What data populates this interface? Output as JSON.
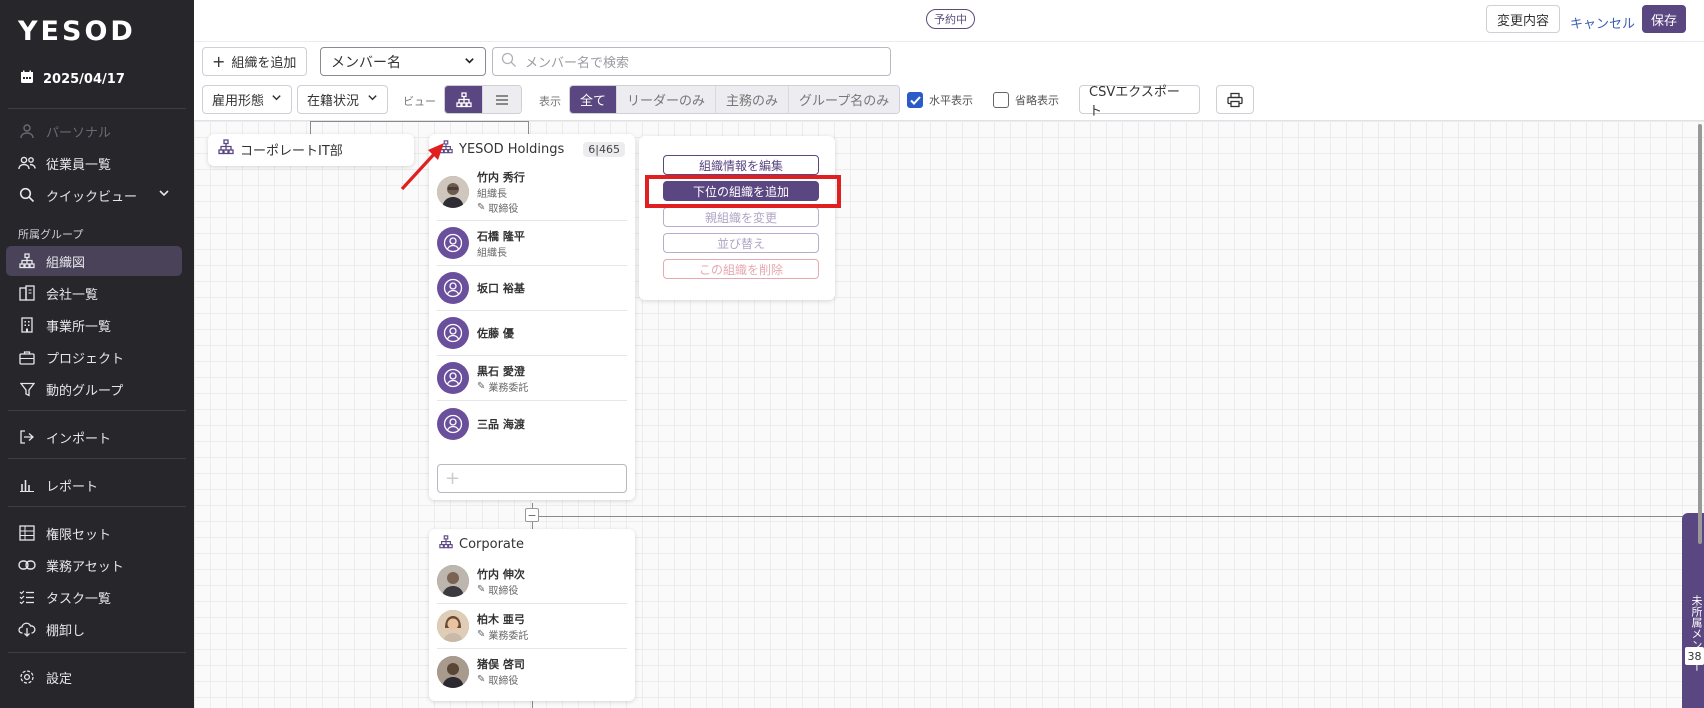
{
  "sidebar": {
    "logo": "YESOD",
    "date": "2025/04/17",
    "items_top": [
      {
        "label": "パーソナル",
        "icon": "person-icon",
        "muted": true
      },
      {
        "label": "従業員一覧",
        "icon": "people-icon"
      },
      {
        "label": "クイックビュー",
        "icon": "search-icon"
      }
    ],
    "section_label": "所属グループ",
    "items_group": [
      {
        "label": "組織図",
        "icon": "org-chart-icon",
        "active": true
      },
      {
        "label": "会社一覧",
        "icon": "company-icon"
      },
      {
        "label": "事業所一覧",
        "icon": "building-icon"
      },
      {
        "label": "プロジェクト",
        "icon": "briefcase-icon"
      },
      {
        "label": "動的グループ",
        "icon": "filter-icon"
      }
    ],
    "import": "インポート",
    "report": "レポート",
    "items_admin": [
      {
        "label": "権限セット",
        "icon": "grid-icon"
      },
      {
        "label": "業務アセット",
        "icon": "link-icon"
      },
      {
        "label": "タスク一覧",
        "icon": "task-list-icon"
      },
      {
        "label": "棚卸し",
        "icon": "cloud-download-icon"
      }
    ],
    "settings": "設定"
  },
  "topbar": {
    "status_badge": "予約中",
    "changes_button": "変更内容",
    "cancel_button": "キャンセル",
    "save_button": "保存"
  },
  "toolbar": {
    "add_org_button": "組織を追加",
    "member_select": "メンバー名",
    "search_placeholder": "メンバー名で検索",
    "employment_filter": "雇用形態",
    "status_filter": "在籍状況",
    "view_label": "ビュー",
    "display_label": "表示",
    "display_options": [
      "全て",
      "リーダーのみ",
      "主務のみ",
      "グループ名のみ"
    ],
    "display_selected": "全て",
    "horizontal_label": "水平表示",
    "horizontal_checked": true,
    "compact_label": "省略表示",
    "compact_checked": false,
    "csv_button": "CSVエクスポート"
  },
  "org_chart": {
    "left_card": {
      "name": "コーポレートIT部"
    },
    "main_card": {
      "name": "YESOD Holdings",
      "count": "6|465",
      "members": [
        {
          "name": "竹内 秀行",
          "role": "組織長",
          "tag": "取締役",
          "photo": true
        },
        {
          "name": "石橋 隆平",
          "role": "組織長",
          "tag": "",
          "photo": false
        },
        {
          "name": "坂口 裕基",
          "role": "",
          "tag": "",
          "photo": false
        },
        {
          "name": "佐藤 優",
          "role": "",
          "tag": "",
          "photo": false
        },
        {
          "name": "黒石 愛澄",
          "role": "",
          "tag": "業務委託",
          "photo": false
        },
        {
          "name": "三品 海渡",
          "role": "",
          "tag": "",
          "photo": false
        }
      ],
      "add_symbol": "+"
    },
    "context_menu": {
      "edit": "組織情報を編集",
      "add_child": "下位の組織を追加",
      "change_parent": "親組織を変更",
      "sort": "並び替え",
      "delete": "この組織を削除"
    },
    "child_card": {
      "name": "Corporate",
      "members": [
        {
          "name": "竹内 伸次",
          "tag": "取締役"
        },
        {
          "name": "柏木 亜弓",
          "tag": "業務委託"
        },
        {
          "name": "猪俣 啓司",
          "tag": "取締役"
        }
      ]
    },
    "collapse_symbol": "−"
  },
  "unassigned": {
    "label": "未所属メンバー",
    "count": "38"
  },
  "colors": {
    "sidebar_bg": "#26262b",
    "accent": "#5a4680",
    "highlight": "#e02020",
    "link": "#3a5eb5"
  }
}
